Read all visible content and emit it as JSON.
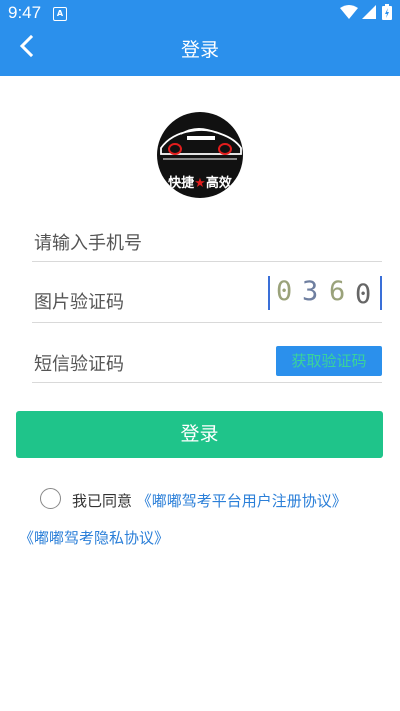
{
  "status_bar": {
    "time": "9:47",
    "notification_badge": "A"
  },
  "header": {
    "title": "登录",
    "back_icon": "chevron-left-icon"
  },
  "logo": {
    "text_left": "快捷",
    "star": "★",
    "text_right": "高效"
  },
  "form": {
    "phone_placeholder": "请输入手机号",
    "image_captcha_placeholder": "图片验证码",
    "captcha_chars": [
      "0",
      "3",
      "6",
      "0"
    ],
    "sms_code_placeholder": "短信验证码",
    "sms_button_label": "获取验证码"
  },
  "login_button_label": "登录",
  "agreement": {
    "prefix": "我已同意",
    "user_agreement_link": "《嘟嘟驾考平台用户注册协议》",
    "privacy_link": "《嘟嘟驾考隐私协议》"
  },
  "colors": {
    "primary_blue": "#2b90ec",
    "login_green": "#1fc48a",
    "link_blue": "#2b7fd8"
  }
}
